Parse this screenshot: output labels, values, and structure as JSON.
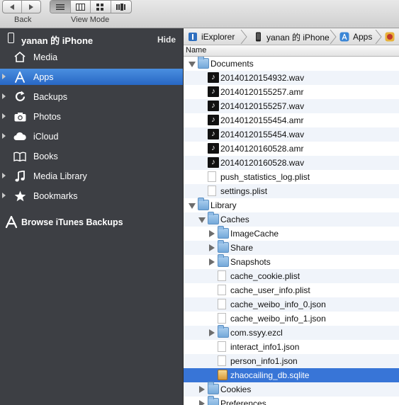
{
  "toolbar": {
    "back_label": "Back",
    "view_mode_label": "View Mode",
    "nav_buttons": [
      {
        "icon": "left-arrow-icon",
        "glyph": "◀"
      },
      {
        "icon": "right-arrow-icon",
        "glyph": "▶"
      }
    ],
    "view_buttons": [
      {
        "icon": "list-view-icon",
        "active": true
      },
      {
        "icon": "column-view-icon",
        "active": false
      },
      {
        "icon": "grid-view-icon",
        "active": false
      },
      {
        "icon": "cover-flow-icon",
        "active": false
      }
    ]
  },
  "sidebar": {
    "device_name": "yanan 的 iPhone",
    "hide_label": "Hide",
    "items": [
      {
        "label": "Media",
        "icon": "home-icon",
        "disclosure": false,
        "selected": false
      },
      {
        "label": "Apps",
        "icon": "app-store-icon",
        "disclosure": true,
        "selected": true
      },
      {
        "label": "Backups",
        "icon": "backup-icon",
        "disclosure": true,
        "selected": false
      },
      {
        "label": "Photos",
        "icon": "camera-icon",
        "disclosure": true,
        "selected": false
      },
      {
        "label": "iCloud",
        "icon": "cloud-icon",
        "disclosure": true,
        "selected": false
      },
      {
        "label": "Books",
        "icon": "book-icon",
        "disclosure": false,
        "selected": false
      },
      {
        "label": "Media Library",
        "icon": "music-note-icon",
        "disclosure": true,
        "selected": false
      },
      {
        "label": "Bookmarks",
        "icon": "star-icon",
        "disclosure": true,
        "selected": false
      }
    ],
    "browse_label": "Browse iTunes Backups"
  },
  "breadcrumb": {
    "items": [
      {
        "label": "iExplorer",
        "icon": "iexplorer-icon"
      },
      {
        "label": "yanan 的 iPhone",
        "icon": "iphone-icon"
      },
      {
        "label": "Apps",
        "icon": "apps-icon"
      },
      {
        "label": "",
        "icon": "app-icon"
      }
    ]
  },
  "file_list": {
    "column_header": "Name",
    "rows": [
      {
        "label": "Documents",
        "type": "folder",
        "depth": 0,
        "expand": "open"
      },
      {
        "label": "20140120154932.wav",
        "type": "audio",
        "depth": 1,
        "expand": "none"
      },
      {
        "label": "20140120155257.amr",
        "type": "audio",
        "depth": 1,
        "expand": "none"
      },
      {
        "label": "20140120155257.wav",
        "type": "audio",
        "depth": 1,
        "expand": "none"
      },
      {
        "label": "20140120155454.amr",
        "type": "audio",
        "depth": 1,
        "expand": "none"
      },
      {
        "label": "20140120155454.wav",
        "type": "audio",
        "depth": 1,
        "expand": "none"
      },
      {
        "label": "20140120160528.amr",
        "type": "audio",
        "depth": 1,
        "expand": "none"
      },
      {
        "label": "20140120160528.wav",
        "type": "audio",
        "depth": 1,
        "expand": "none"
      },
      {
        "label": "push_statistics_log.plist",
        "type": "file",
        "depth": 1,
        "expand": "none"
      },
      {
        "label": "settings.plist",
        "type": "file",
        "depth": 1,
        "expand": "none"
      },
      {
        "label": "Library",
        "type": "folder",
        "depth": 0,
        "expand": "open"
      },
      {
        "label": "Caches",
        "type": "folder",
        "depth": 1,
        "expand": "open"
      },
      {
        "label": "ImageCache",
        "type": "folder",
        "depth": 2,
        "expand": "closed"
      },
      {
        "label": "Share",
        "type": "folder",
        "depth": 2,
        "expand": "closed"
      },
      {
        "label": "Snapshots",
        "type": "folder",
        "depth": 2,
        "expand": "closed"
      },
      {
        "label": "cache_cookie.plist",
        "type": "file",
        "depth": 2,
        "expand": "none"
      },
      {
        "label": "cache_user_info.plist",
        "type": "file",
        "depth": 2,
        "expand": "none"
      },
      {
        "label": "cache_weibo_info_0.json",
        "type": "file",
        "depth": 2,
        "expand": "none"
      },
      {
        "label": "cache_weibo_info_1.json",
        "type": "file",
        "depth": 2,
        "expand": "none"
      },
      {
        "label": "com.ssyy.ezcl",
        "type": "folder",
        "depth": 2,
        "expand": "closed"
      },
      {
        "label": "interact_info1.json",
        "type": "file",
        "depth": 2,
        "expand": "none"
      },
      {
        "label": "person_info1.json",
        "type": "file",
        "depth": 2,
        "expand": "none"
      },
      {
        "label": "zhaocailing_db.sqlite",
        "type": "sqlite",
        "depth": 2,
        "expand": "none",
        "selected": true
      },
      {
        "label": "Cookies",
        "type": "folder",
        "depth": 1,
        "expand": "closed"
      },
      {
        "label": "Preferences",
        "type": "folder",
        "depth": 1,
        "expand": "closed"
      }
    ]
  },
  "colors": {
    "sidebar_bg": "#3d3f44",
    "selection_blue": "#3875d7",
    "sidebar_selection": "#2f72d0"
  }
}
